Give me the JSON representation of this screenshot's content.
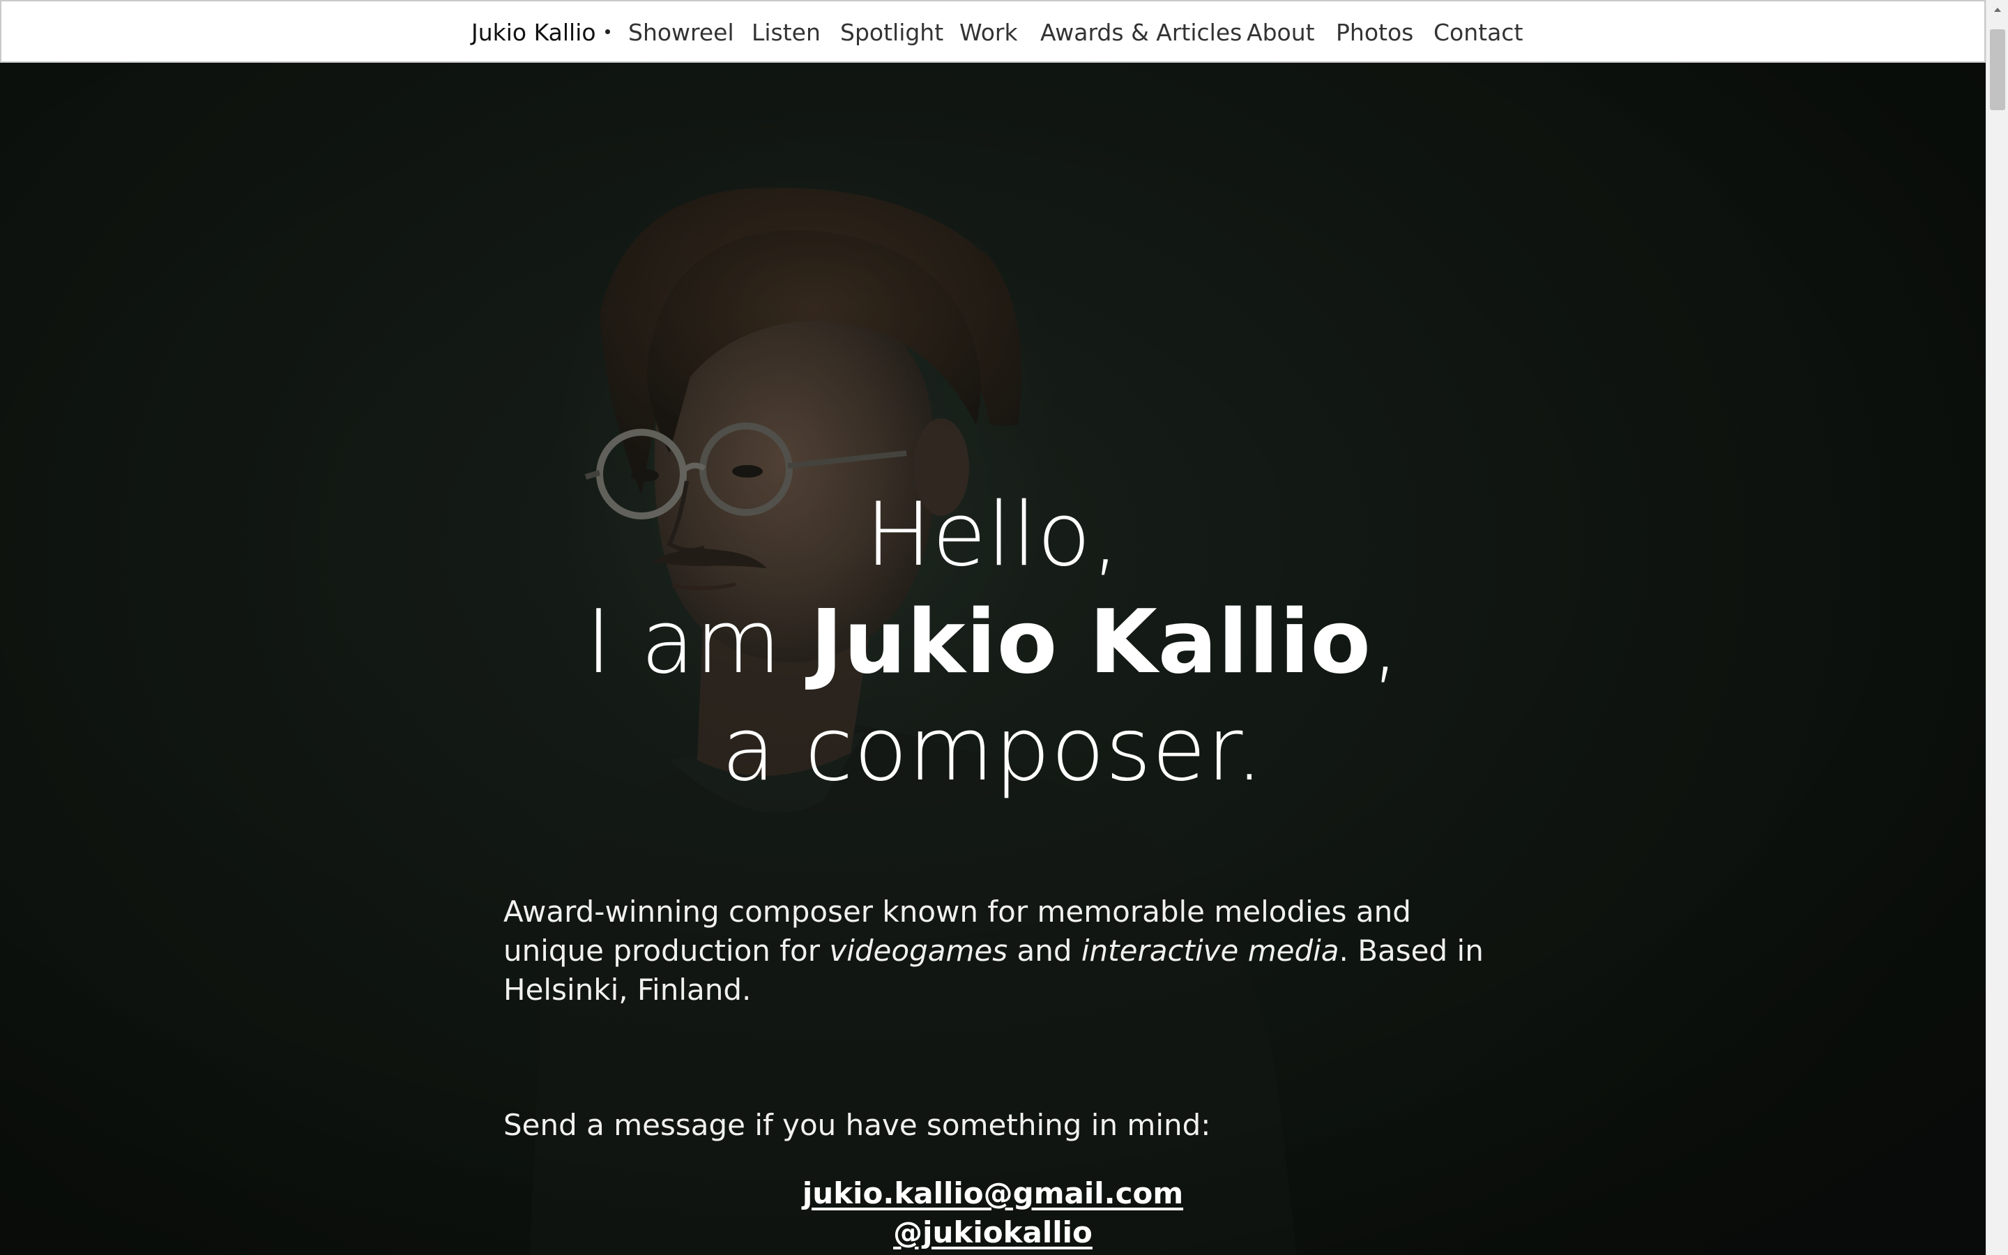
{
  "nav": {
    "brand": "Jukio Kallio",
    "items": [
      {
        "label": "Showreel"
      },
      {
        "label": "Listen"
      },
      {
        "label": "Spotlight"
      },
      {
        "label": "Work"
      },
      {
        "label": "Awards & Articles"
      },
      {
        "label": "About"
      },
      {
        "label": "Photos"
      },
      {
        "label": "Contact"
      }
    ]
  },
  "hero": {
    "greeting": "Hello,",
    "intro_prefix": "I am ",
    "name": "Jukio Kallio",
    "intro_suffix": ",",
    "role": "a composer.",
    "description": {
      "part1": "Award-winning composer known for memorable melodies and unique production for ",
      "em1": "videogames",
      "part2": " and ",
      "em2": "interactive media",
      "part3": ". Based in Helsinki, Finland."
    },
    "message_prompt": "Send a message if you have something in mind:",
    "email": "jukio.kallio@gmail.com",
    "handle": "@jukiokallio"
  },
  "colors": {
    "nav_background": "#ffffff",
    "hero_background": "#141a16",
    "hero_text": "#ffffff"
  }
}
